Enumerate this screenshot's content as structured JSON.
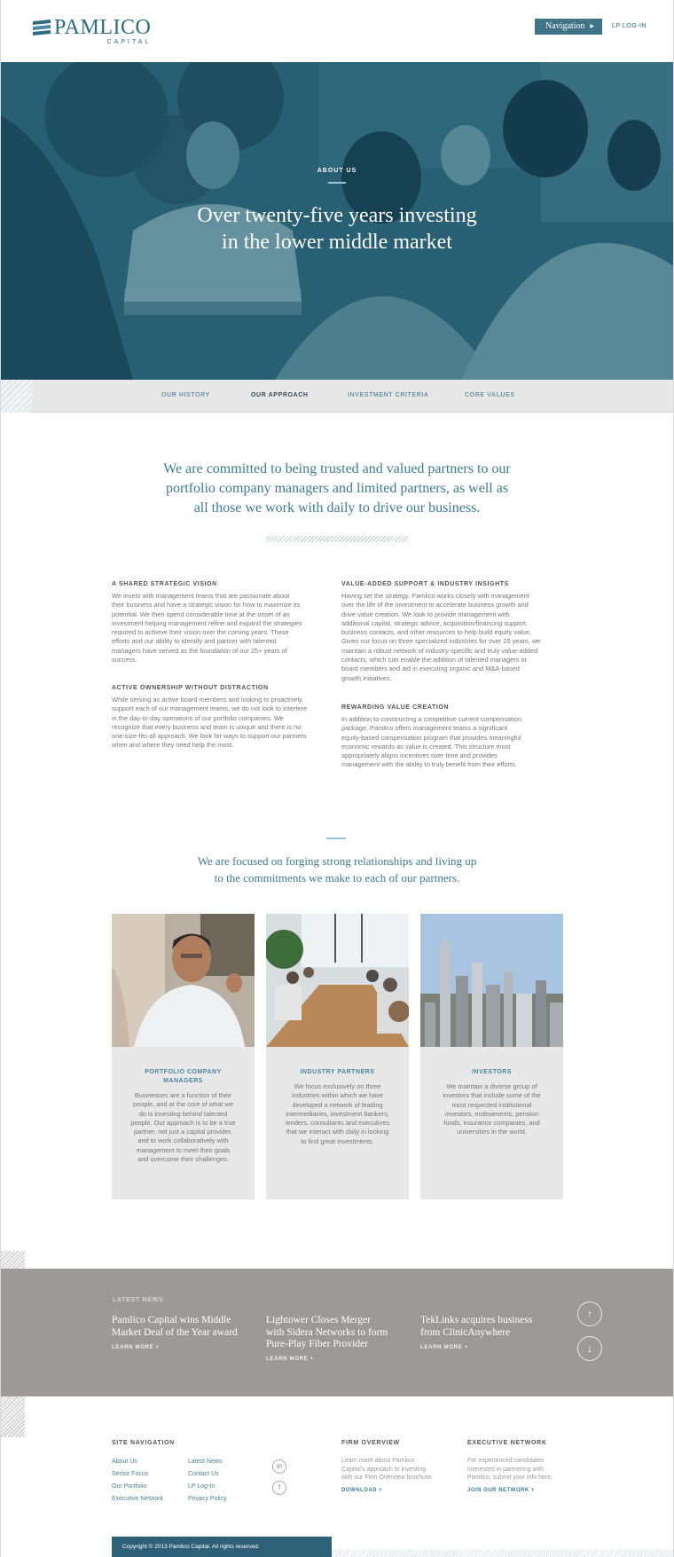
{
  "header": {
    "logo_name": "PAMLICO",
    "logo_sub": "CAPITAL",
    "nav_button": "Navigation",
    "lp_login": "LP LOG-IN"
  },
  "hero": {
    "eyebrow": "ABOUT US",
    "title_line1": "Over twenty-five years investing",
    "title_line2": "in the lower middle market"
  },
  "subnav": {
    "items": [
      "OUR HISTORY",
      "OUR APPROACH",
      "INVESTMENT CRITERIA",
      "CORE VALUES"
    ],
    "active": "OUR APPROACH"
  },
  "mission": {
    "line1": "We are committed to being trusted and valued partners to our",
    "line2": "portfolio company managers and limited partners, as well as",
    "line3": "all those we work with daily to drive our business."
  },
  "approach": {
    "left": [
      {
        "heading": "A SHARED STRATEGIC VISION",
        "lines": [
          "We invest with management teams that are passionate about",
          "their business and have a strategic vision for how to maximize its",
          "potential. We then spend considerable time at the onset of an",
          "investment helping management refine and expand the strategies",
          "required to achieve their vision over the coming years. These",
          "efforts and our ability to identify and partner with talented",
          "managers have served as the foundation of our 25+ years of",
          "success."
        ]
      },
      {
        "heading": "ACTIVE OWNERSHIP WITHOUT DISTRACTION",
        "lines": [
          "While serving as active board members and looking to proactively",
          "support each of our management teams, we do not look to interfere",
          "in the day-to-day operations of our portfolio companies. We",
          "recognize that every business and team is unique and there is no",
          "one-size-fits-all approach. We look for ways to support our partners",
          "when and where they need help the most."
        ]
      }
    ],
    "right": [
      {
        "heading": "VALUE-ADDED SUPPORT & INDUSTRY INSIGHTS",
        "lines": [
          "Having set the strategy, Pamlico works closely with management",
          "over the life of the investment to accelerate business growth and",
          "drive value creation. We look to provide management with",
          "additional capital, strategic advice, acquisition/financing support,",
          "business contacts, and other resources to help build equity value.",
          "Given our focus on three specialized industries for over 25 years, we",
          "maintain a robust network of industry-specific and truly value-added",
          "contacts, which can enable the addition of talented managers or",
          "board members and aid in executing organic and M&A-based",
          "growth initiatives."
        ]
      },
      {
        "heading": "REWARDING VALUE CREATION",
        "lines": [
          "In addition to constructing a competitive current compensation",
          "package, Pamlico offers management teams a significant",
          "equity-based compensation program that provides meaningful",
          "economic rewards as value is created. This structure most",
          "appropriately aligns incentives over time and provides",
          "management with the ability to truly benefit from their efforts."
        ]
      }
    ]
  },
  "focus": {
    "line1": "We are focused on forging strong relationships and living up",
    "line2": "to the commitments we make to each of our partners."
  },
  "cards": [
    {
      "title_lines": [
        "PORTFOLIO COMPANY",
        "MANAGERS"
      ],
      "lines": [
        "Businesses are a function of their",
        "people, and at the core of what we",
        "do is investing behind talented",
        "people. Our approach is to be a true",
        "partner, not just a capital provider,",
        "and to work collaboratively with",
        "management to meet their goals",
        "and overcome their challenges."
      ]
    },
    {
      "title_lines": [
        "INDUSTRY PARTNERS"
      ],
      "lines": [
        "We focus exclusively on three",
        "industries within which we have",
        "developed a network of leading",
        "intermediaries, investment bankers,",
        "lenders, consultants and executives",
        "that we interact with daily in looking",
        "to find great investments."
      ]
    },
    {
      "title_lines": [
        "INVESTORS"
      ],
      "lines": [
        "We maintain a diverse group of",
        "investors that include some of the",
        "most respected institutional",
        "investors, endowments, pension",
        "funds, insurance companies, and",
        "universities in the world."
      ]
    }
  ],
  "news": {
    "eyebrow": "LATEST NEWS",
    "items": [
      {
        "title_lines": [
          "Pamlico Capital wins Middle",
          "Market Deal of the Year award"
        ],
        "more": "LEARN MORE +"
      },
      {
        "title_lines": [
          "Lightower Closes Merger",
          "with Sidera Networks to form",
          "Pure-Play Fiber Provider"
        ],
        "more": "LEARN MORE +"
      },
      {
        "title_lines": [
          "TekLinks acquires business",
          "from ClinicAnywhere"
        ],
        "more": "LEARN MORE +"
      }
    ],
    "up": "↑",
    "down": "↓"
  },
  "footer": {
    "site_nav_heading": "SITE NAVIGATION",
    "col1": [
      "About Us",
      "Sector Focus",
      "Our Portfolio",
      "Executive Network"
    ],
    "col2": [
      "Latest News",
      "Contact Us",
      "LP Log-In",
      "Privacy Policy"
    ],
    "social": [
      "in",
      "f"
    ],
    "firm_heading": "FIRM OVERVIEW",
    "firm_lines": [
      "Learn more about Pamlico",
      "Capital's approach to investing",
      "with our Firm Overview brochure."
    ],
    "firm_cta": "DOWNLOAD +",
    "exec_heading": "EXECUTIVE NETWORK",
    "exec_lines": [
      "For experienced candidates",
      "interested in partnering with",
      "Pamlico, submit your info here."
    ],
    "exec_cta": "JOIN OUR NETWORK +",
    "copyright": "Copyright © 2013 Pamlico Capital. All rights reserved."
  }
}
